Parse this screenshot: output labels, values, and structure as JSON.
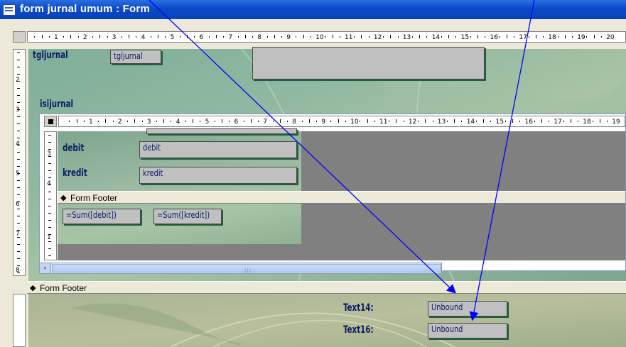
{
  "window": {
    "title": "form jurnal umum : Form"
  },
  "main_ruler": {
    "numbers": [
      "1",
      "2",
      "3",
      "4",
      "5",
      "6",
      "7",
      "8",
      "9",
      "10",
      "11",
      "12",
      "13",
      "14",
      "15",
      "16",
      "17",
      "18",
      "19",
      "20"
    ]
  },
  "sub_ruler": {
    "numbers": [
      "1",
      "2",
      "3",
      "4",
      "5",
      "6",
      "7",
      "8",
      "9",
      "10",
      "11",
      "12",
      "13",
      "14",
      "15",
      "16",
      "17",
      "18",
      "19"
    ]
  },
  "left_ruler": {
    "numbers": [
      "2",
      "3",
      "4",
      "5",
      "6",
      "7",
      "8",
      "1"
    ]
  },
  "sub_left_ruler": {
    "numbers": [
      "3",
      "4",
      "1"
    ]
  },
  "header": {
    "tgljurnal_label": "tgljurnal",
    "tgljurnal_box": "tgljurnal",
    "isijurnal_label": "isijurnal"
  },
  "subform": {
    "debit_label": "debit",
    "debit_box": "debit",
    "kredit_label": "kredit",
    "kredit_box": "kredit",
    "footer_label": "Form Footer",
    "sum_debit": "=Sum([debit])",
    "sum_kredit": "=Sum([kredit])"
  },
  "form_footer": {
    "label": "Form Footer",
    "text14_label": "Text14:",
    "text14_box": "Unbound",
    "text16_label": "Text16:",
    "text16_box": "Unbound"
  },
  "colors": {
    "arrow": "#0000ff",
    "title_bar": "#0a49c8"
  }
}
